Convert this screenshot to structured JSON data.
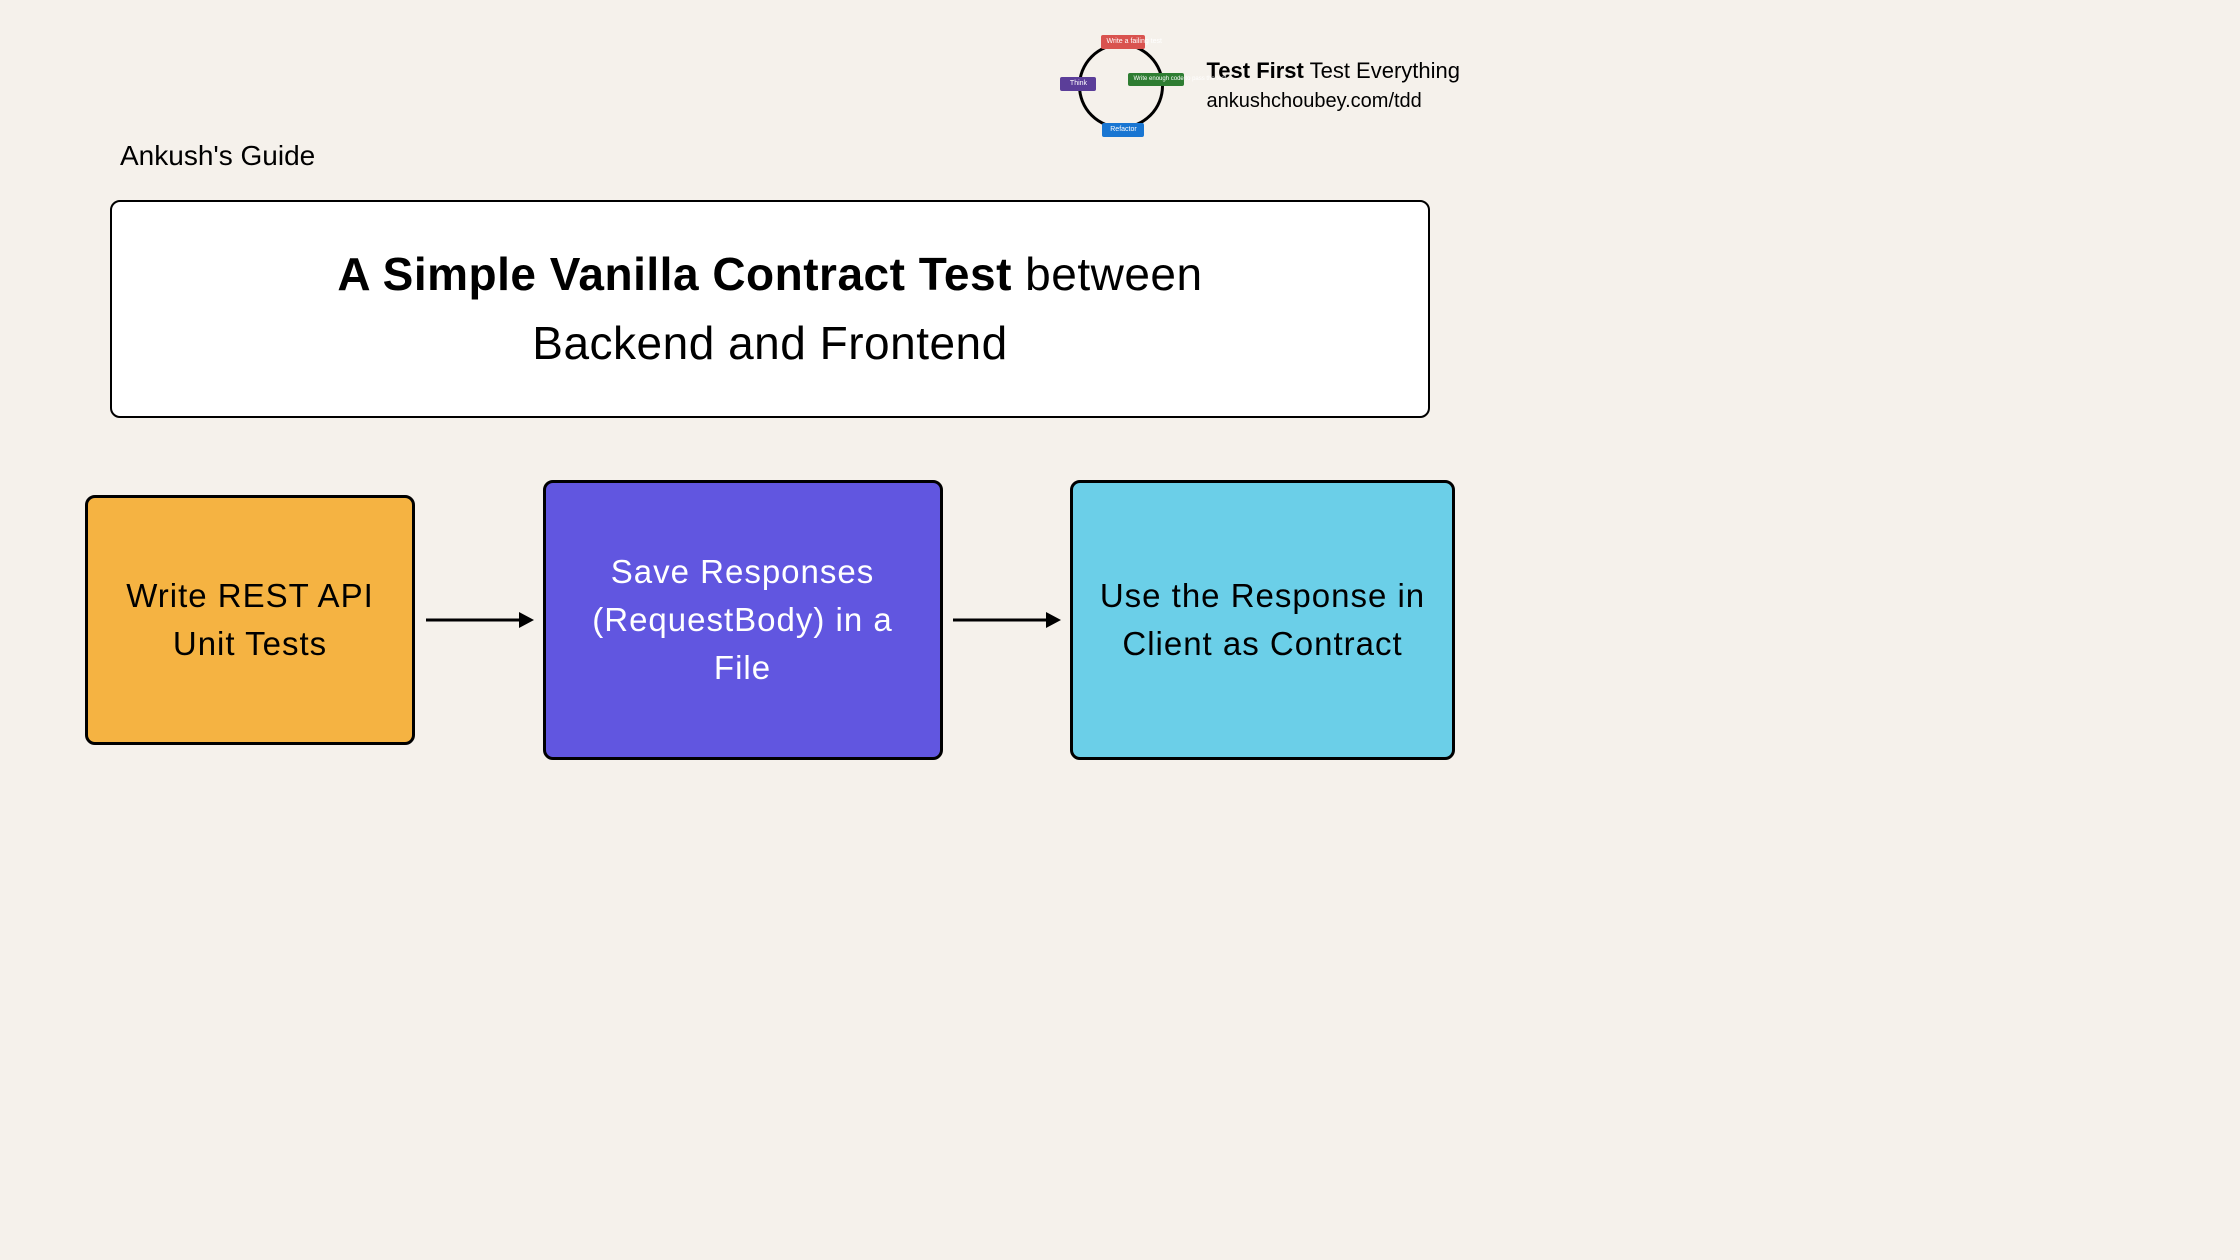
{
  "guide_label": "Ankush's Guide",
  "title": {
    "bold": "A Simple Vanilla Contract Test",
    "regular_between": " between",
    "line2": "Backend and Frontend"
  },
  "header": {
    "title_bold": "Test First",
    "title_regular": " Test Everything",
    "url": "ankushchoubey.com/tdd",
    "cycle": {
      "write_fail": "Write a failing test",
      "think": "Think",
      "write_enough": "Write enough code to pass the test",
      "refactor": "Refactor"
    }
  },
  "flow": {
    "step1": "Write REST API Unit Tests",
    "step2": "Save Responses (RequestBody) in a File",
    "step3": "Use the Response in Client as Contract"
  }
}
